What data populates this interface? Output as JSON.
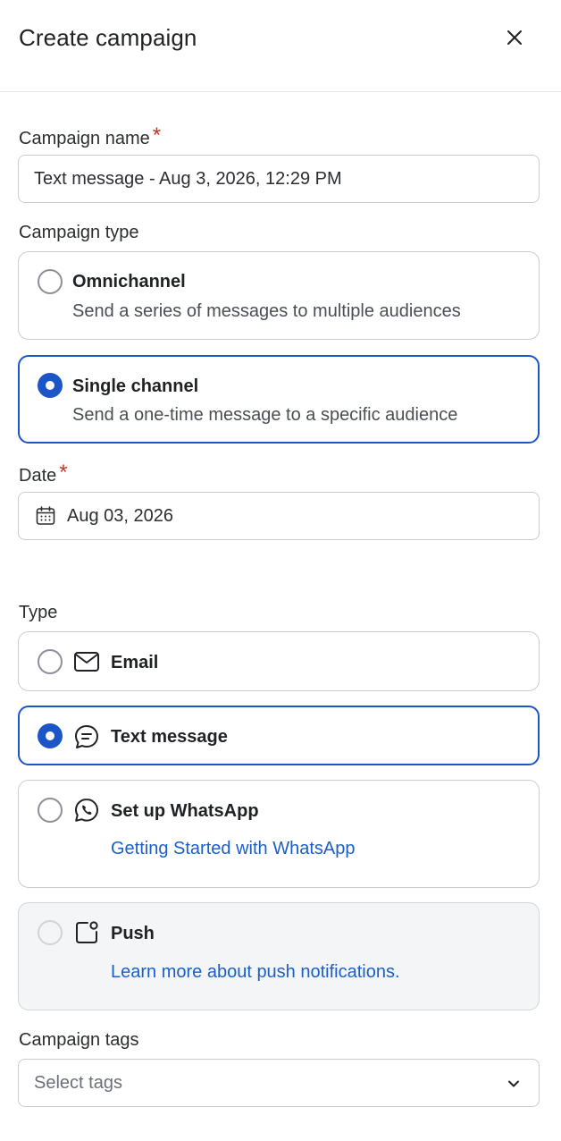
{
  "header": {
    "title": "Create campaign"
  },
  "campaign_name": {
    "label": "Campaign name",
    "required_mark": "*",
    "value": "Text message - Aug 3, 2026, 12:29 PM"
  },
  "campaign_type": {
    "label": "Campaign type",
    "options": [
      {
        "title": "Omnichannel",
        "description": "Send a series of messages to multiple audiences",
        "selected": false
      },
      {
        "title": "Single channel",
        "description": "Send a one-time message to a specific audience",
        "selected": true
      }
    ]
  },
  "date": {
    "label": "Date",
    "required_mark": "*",
    "value": "Aug 03, 2026"
  },
  "type": {
    "label": "Type",
    "options": [
      {
        "title": "Email",
        "icon": "mail-icon",
        "selected": false
      },
      {
        "title": "Text message",
        "icon": "chat-bubble-icon",
        "selected": true
      },
      {
        "title": "Set up WhatsApp",
        "icon": "whatsapp-icon",
        "link": "Getting Started with WhatsApp",
        "selected": false
      },
      {
        "title": "Push",
        "icon": "push-notification-icon",
        "link": "Learn more about push notifications.",
        "selected": false,
        "disabled": true
      }
    ]
  },
  "campaign_tags": {
    "label": "Campaign tags",
    "placeholder": "Select tags"
  },
  "colors": {
    "accent": "#1a56c7",
    "link": "#1a5fc9",
    "required": "#c0392b",
    "border": "#c9ccd1",
    "disabled_bg": "#f3f5f7"
  }
}
